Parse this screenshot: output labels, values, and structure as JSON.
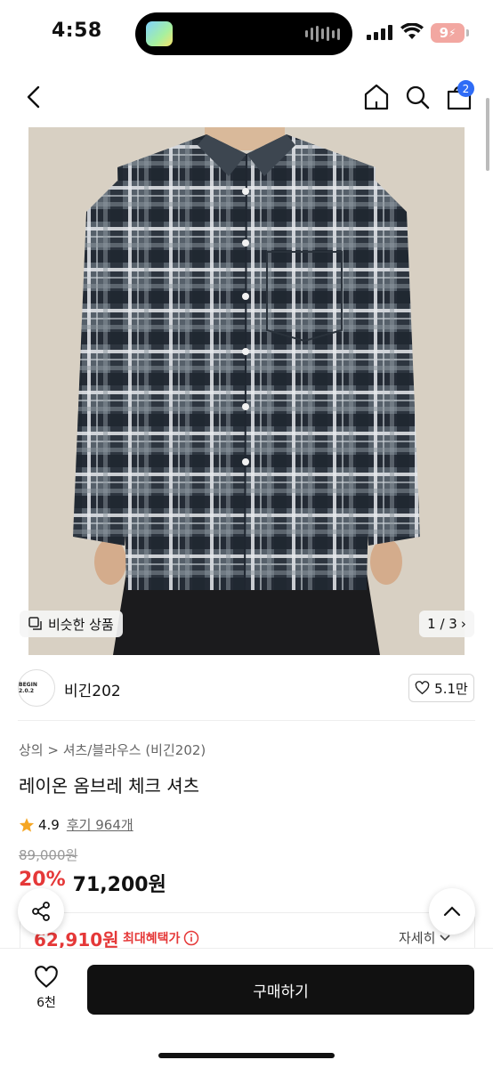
{
  "status_bar": {
    "time": "4:58",
    "battery": "9"
  },
  "nav": {
    "cart_badge": "2"
  },
  "image": {
    "similar_label": "비슷한 상품",
    "pager": "1 / 3"
  },
  "brand": {
    "logo_text": "BEGIN 2.0.2",
    "name": "비긴202",
    "likes": "5.1만"
  },
  "product": {
    "breadcrumb": "상의 > 셔츠/블라우스 (비긴202)",
    "title": "레이온 옴브레 체크 셔츠",
    "rating": "4.9",
    "reviews": "후기 964개",
    "original_price": "89,000원",
    "discount": "20%",
    "sale_price": "71,200원",
    "max_benefit_price": "62,910원",
    "max_benefit_label": "최대혜택가",
    "detail_link": "자세히"
  },
  "bottom": {
    "wish_count": "6천",
    "buy_label": "구매하기"
  },
  "colors": {
    "accent_red": "#e53838",
    "badge_blue": "#2f6cf6",
    "buy_button": "#111111"
  }
}
